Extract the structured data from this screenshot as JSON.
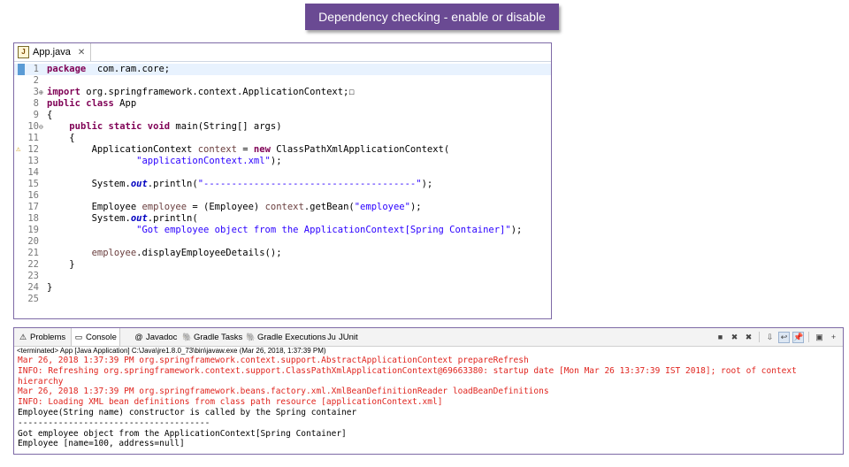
{
  "banner": {
    "title": "Dependency checking - enable or disable"
  },
  "editor": {
    "tab_label": "App.java",
    "lines": [
      {
        "n": "1",
        "segments": [
          [
            "kw",
            "package"
          ],
          [
            "",
            "  com.ram.core;"
          ]
        ]
      },
      {
        "n": "2",
        "segments": []
      },
      {
        "n": "3",
        "segments": [
          [
            "kw",
            "import"
          ],
          [
            "",
            " org.springframework.context.ApplicationContext;"
          ]
        ]
      },
      {
        "n": "8",
        "segments": [
          [
            "kw",
            "public class"
          ],
          [
            "",
            " App"
          ]
        ]
      },
      {
        "n": "9",
        "segments": [
          [
            "",
            "{"
          ]
        ]
      },
      {
        "n": "10",
        "segments": [
          [
            "",
            "    "
          ],
          [
            "kw",
            "public static void"
          ],
          [
            "",
            " main(String[] args)"
          ]
        ]
      },
      {
        "n": "11",
        "segments": [
          [
            "",
            "    {"
          ]
        ]
      },
      {
        "n": "12",
        "segments": [
          [
            "",
            "        ApplicationContext "
          ],
          [
            "var",
            "context"
          ],
          [
            "",
            " = "
          ],
          [
            "kw",
            "new"
          ],
          [
            "",
            " ClassPathXmlApplicationContext("
          ]
        ]
      },
      {
        "n": "13",
        "segments": [
          [
            "",
            "                "
          ],
          [
            "str",
            "\"applicationContext.xml\""
          ],
          [
            "",
            ");"
          ]
        ]
      },
      {
        "n": "14",
        "segments": []
      },
      {
        "n": "15",
        "segments": [
          [
            "",
            "        System."
          ],
          [
            "field",
            "out"
          ],
          [
            "",
            ".println("
          ],
          [
            "str",
            "\"--------------------------------------\""
          ],
          [
            "",
            ");"
          ]
        ]
      },
      {
        "n": "16",
        "segments": []
      },
      {
        "n": "17",
        "segments": [
          [
            "",
            "        Employee "
          ],
          [
            "var",
            "employee"
          ],
          [
            "",
            " = (Employee) "
          ],
          [
            "var",
            "context"
          ],
          [
            "",
            ".getBean("
          ],
          [
            "str",
            "\"employee\""
          ],
          [
            "",
            ");"
          ]
        ]
      },
      {
        "n": "18",
        "segments": [
          [
            "",
            "        System."
          ],
          [
            "field",
            "out"
          ],
          [
            "",
            ".println("
          ]
        ]
      },
      {
        "n": "19",
        "segments": [
          [
            "",
            "                "
          ],
          [
            "str",
            "\"Got employee object from the ApplicationContext[Spring Container]\""
          ],
          [
            "",
            ");"
          ]
        ]
      },
      {
        "n": "20",
        "segments": []
      },
      {
        "n": "21",
        "segments": [
          [
            "",
            "        "
          ],
          [
            "var",
            "employee"
          ],
          [
            "",
            ".displayEmployeeDetails();"
          ]
        ]
      },
      {
        "n": "22",
        "segments": [
          [
            "",
            "    }"
          ]
        ]
      },
      {
        "n": "23",
        "segments": []
      },
      {
        "n": "24",
        "segments": [
          [
            "",
            "}"
          ]
        ]
      },
      {
        "n": "25",
        "segments": []
      }
    ]
  },
  "console": {
    "tabs": [
      {
        "label": "Problems",
        "icon": "problems-icon",
        "glyph": "⚠"
      },
      {
        "label": "Console",
        "icon": "console-icon",
        "glyph": "▭",
        "active": true
      },
      {
        "label": "Javadoc",
        "icon": "javadoc-icon",
        "glyph": "@"
      },
      {
        "label": "Gradle Tasks",
        "icon": "gradle-tasks-icon",
        "glyph": "🐘"
      },
      {
        "label": "Gradle Executions",
        "icon": "gradle-executions-icon",
        "glyph": "🐘"
      },
      {
        "label": "JUnit",
        "icon": "junit-icon",
        "glyph": "Ju"
      }
    ],
    "terminated_text": "<terminated> App [Java Application] C:\\Java\\jre1.8.0_73\\bin\\javaw.exe (Mar 26, 2018, 1:37:39 PM)",
    "output": [
      {
        "text": "Mar 26, 2018 1:37:39 PM org.springframework.context.support.AbstractApplicationContext prepareRefresh",
        "err": true
      },
      {
        "text": "INFO: Refreshing org.springframework.context.support.ClassPathXmlApplicationContext@69663380: startup date [Mon Mar 26 13:37:39 IST 2018]; root of context",
        "err": true
      },
      {
        "text": "hierarchy",
        "err": true
      },
      {
        "text": "Mar 26, 2018 1:37:39 PM org.springframework.beans.factory.xml.XmlBeanDefinitionReader loadBeanDefinitions",
        "err": true
      },
      {
        "text": "INFO: Loading XML bean definitions from class path resource [applicationContext.xml]",
        "err": true
      },
      {
        "text": "Employee(String name) constructor is called by the Spring container",
        "err": false
      },
      {
        "text": "--------------------------------------",
        "err": false
      },
      {
        "text": "Got employee object from the ApplicationContext[Spring Container]",
        "err": false
      },
      {
        "text": "Employee [name=100, address=null]",
        "err": false
      }
    ],
    "toolbar_icons": [
      "terminate-icon",
      "remove-launch-icon",
      "remove-all-icon",
      "scroll-lock-icon",
      "word-wrap-icon",
      "pin-console-icon",
      "display-console-icon",
      "new-console-icon"
    ]
  }
}
